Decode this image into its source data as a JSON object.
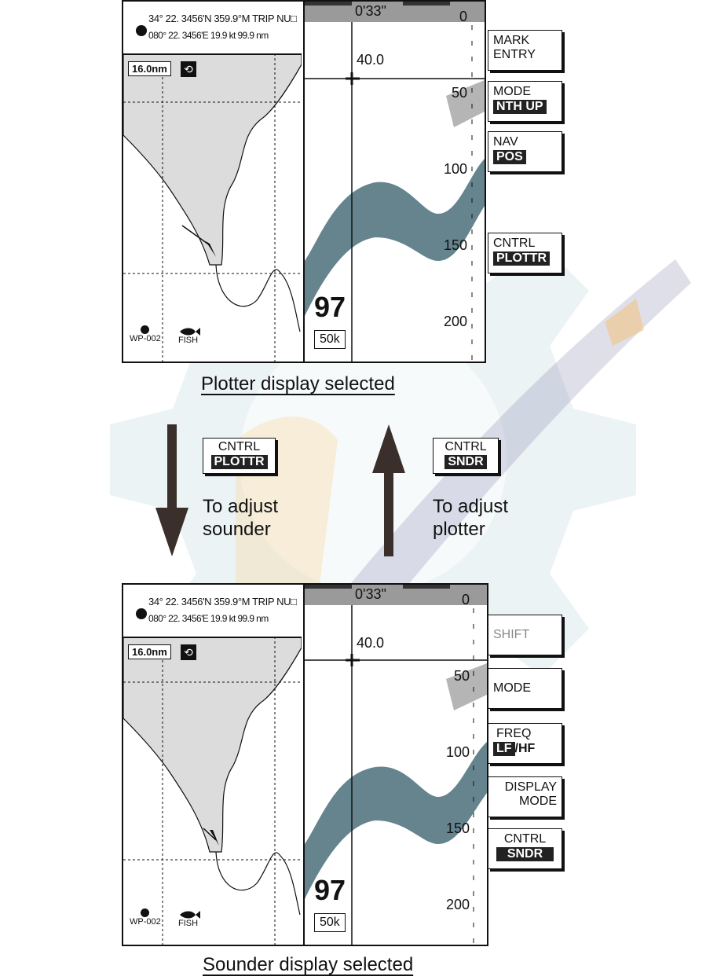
{
  "panels": [
    {
      "id": "plotter",
      "header": {
        "line1": "34° 22. 3456'N  359.9°M TRIP  NU□",
        "line2": "080° 22. 3456'E  19.9 kt    99.9 nm"
      },
      "range": "16.0nm",
      "rotation_icon": "rotate-icon",
      "waypoint_label": "WP-002",
      "fish_label": "FISH",
      "time": "0'33\"",
      "vrm": "40.0",
      "depth": "97",
      "frequency": "50k",
      "depth_scale": [
        "0",
        "50",
        "100",
        "150",
        "200"
      ],
      "caption": "Plotter display selected",
      "buttons": [
        {
          "line1": "MARK",
          "line2": "ENTRY",
          "style": "plain"
        },
        {
          "line1": "MODE",
          "line2": "NTH UP",
          "style": "highlight"
        },
        {
          "line1": "NAV",
          "line2": "POS",
          "style": "highlight"
        },
        {
          "line1": "CNTRL",
          "line2": "PLOTTR",
          "style": "highlight"
        }
      ]
    },
    {
      "id": "sounder",
      "header": {
        "line1": "34° 22. 3456'N  359.9°M TRIP  NU□",
        "line2": "080° 22. 3456'E  19.9 kt    99.9 nm"
      },
      "range": "16.0nm",
      "rotation_icon": "rotate-icon",
      "waypoint_label": "WP-002",
      "fish_label": "FISH",
      "time": "0'33\"",
      "vrm": "40.0",
      "depth": "97",
      "frequency": "50k",
      "depth_scale": [
        "0",
        "50",
        "100",
        "150",
        "200"
      ],
      "caption": "Sounder display selected",
      "buttons": [
        {
          "line1": "SHIFT",
          "line2": "",
          "style": "grey"
        },
        {
          "line1": "MODE",
          "line2": "",
          "style": "plain"
        },
        {
          "line1": "FREQ",
          "line2_hl": "LF",
          "line2_rest": "/HF",
          "style": "partial"
        },
        {
          "line1": "DISPLAY",
          "line2": "MODE",
          "style": "plain-right"
        },
        {
          "line1": "CNTRL",
          "line2": "SNDR",
          "style": "highlight"
        }
      ]
    }
  ],
  "transition": {
    "left_key": {
      "line1": "CNTRL",
      "line2": "PLOTTR"
    },
    "left_text": [
      "To adjust",
      "sounder"
    ],
    "right_key": {
      "line1": "CNTRL",
      "line2": "SNDR"
    },
    "right_text": [
      "To adjust",
      "plotter"
    ]
  },
  "colors": {
    "echo": "#4a6f7a",
    "land": "#dcdcdc",
    "timebar": "#9a9a9a",
    "key_highlight": "#222222"
  }
}
